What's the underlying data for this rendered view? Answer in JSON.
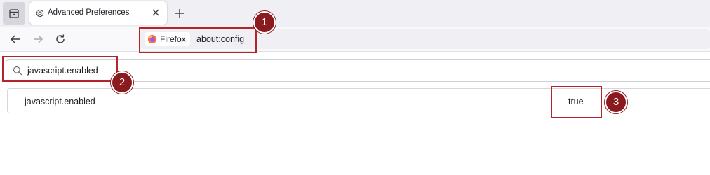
{
  "browser": {
    "tab": {
      "title": "Advanced Preferences"
    },
    "urlbar": {
      "identity_label": "Firefox",
      "url": "about:config"
    }
  },
  "config": {
    "search_value": "javascript.enabled",
    "preferences": [
      {
        "name": "javascript.enabled",
        "value": "true"
      }
    ]
  },
  "annotations": [
    {
      "number": "1"
    },
    {
      "number": "2"
    },
    {
      "number": "3"
    }
  ],
  "colors": {
    "annotation": "#b5242a",
    "badge": "#8b1a1e",
    "tabstrip": "#f0f0f4",
    "firefox_orange": "#ff7139",
    "firefox_purple": "#9059ff"
  },
  "icons": [
    "list-all-tabs-icon",
    "settings-gear-icon",
    "close-icon",
    "plus-icon",
    "back-arrow-icon",
    "forward-arrow-icon",
    "reload-icon",
    "firefox-logo-icon",
    "search-icon"
  ]
}
